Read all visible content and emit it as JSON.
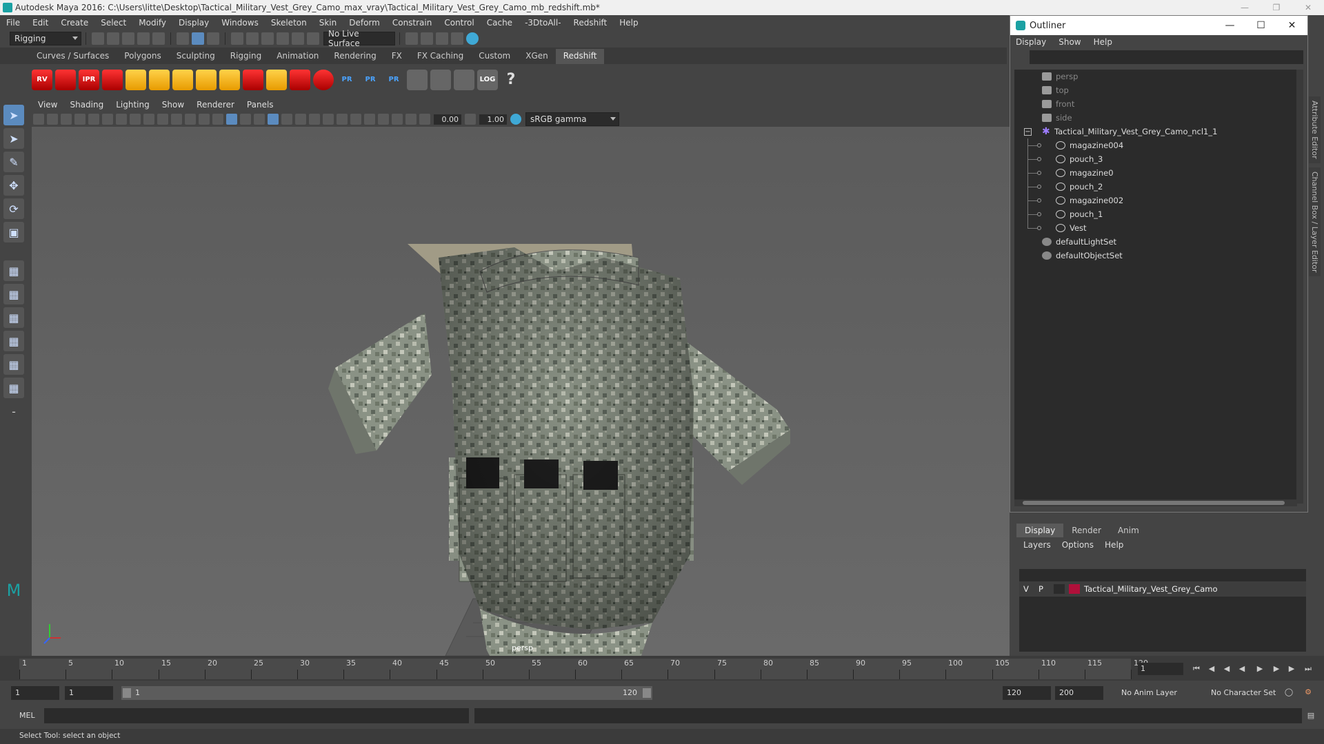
{
  "window": {
    "title": "Autodesk Maya 2016: C:\\Users\\litte\\Desktop\\Tactical_Military_Vest_Grey_Camo_max_vray\\Tactical_Military_Vest_Grey_Camo_mb_redshift.mb*"
  },
  "menubar": [
    "File",
    "Edit",
    "Create",
    "Select",
    "Modify",
    "Display",
    "Windows",
    "Skeleton",
    "Skin",
    "Deform",
    "Constrain",
    "Control",
    "Cache",
    "-3DtoAll-",
    "Redshift",
    "Help"
  ],
  "toolbar": {
    "mode": "Rigging",
    "live_surface": "No Live Surface"
  },
  "shelf": {
    "tabs": [
      "Curves / Surfaces",
      "Polygons",
      "Sculpting",
      "Rigging",
      "Animation",
      "Rendering",
      "FX",
      "FX Caching",
      "Custom",
      "XGen",
      "Redshift"
    ],
    "active_tab": "Redshift",
    "icon_labels": [
      "RV",
      "IPR",
      "PR",
      "PR",
      "PR",
      "LOG",
      "?"
    ]
  },
  "panel": {
    "menus": [
      "View",
      "Shading",
      "Lighting",
      "Show",
      "Renderer",
      "Panels"
    ],
    "exposure": "0.00",
    "gamma": "1.00",
    "color_space": "sRGB gamma",
    "camera_label": "persp"
  },
  "outliner": {
    "title": "Outliner",
    "menus": [
      "Display",
      "Show",
      "Help"
    ],
    "items": [
      {
        "label": "persp",
        "type": "camera",
        "dim": true
      },
      {
        "label": "top",
        "type": "camera",
        "dim": true
      },
      {
        "label": "front",
        "type": "camera",
        "dim": true
      },
      {
        "label": "side",
        "type": "camera",
        "dim": true
      },
      {
        "label": "Tactical_Military_Vest_Grey_Camo_ncl1_1",
        "type": "group"
      },
      {
        "label": "magazine004",
        "type": "mesh"
      },
      {
        "label": "pouch_3",
        "type": "mesh"
      },
      {
        "label": "magazine0",
        "type": "mesh"
      },
      {
        "label": "pouch_2",
        "type": "mesh"
      },
      {
        "label": "magazine002",
        "type": "mesh"
      },
      {
        "label": "pouch_1",
        "type": "mesh"
      },
      {
        "label": "Vest",
        "type": "mesh"
      },
      {
        "label": "defaultLightSet",
        "type": "set"
      },
      {
        "label": "defaultObjectSet",
        "type": "set"
      }
    ]
  },
  "sidetabs": [
    "Attribute Editor",
    "Channel Box / Layer Editor"
  ],
  "layer_editor": {
    "tabs": [
      "Display",
      "Render",
      "Anim"
    ],
    "active_tab": "Display",
    "menus": [
      "Layers",
      "Options",
      "Help"
    ],
    "layer": {
      "v": "V",
      "p": "P",
      "name": "Tactical_Military_Vest_Grey_Camo",
      "color": "#b0103a"
    }
  },
  "timeline": {
    "ticks": [
      "1",
      "5",
      "10",
      "15",
      "20",
      "25",
      "30",
      "35",
      "40",
      "45",
      "50",
      "55",
      "60",
      "65",
      "70",
      "75",
      "80",
      "85",
      "90",
      "95",
      "100",
      "105",
      "110",
      "115",
      "120"
    ],
    "current_frame": "1"
  },
  "range": {
    "start": "1",
    "playback_start": "1",
    "slider_start": "1",
    "slider_end": "120",
    "playback_end": "120",
    "end": "200",
    "anim_layer": "No Anim Layer",
    "character_set": "No Character Set"
  },
  "cmd": {
    "lang": "MEL"
  },
  "status": {
    "text": "Select Tool: select an object"
  }
}
